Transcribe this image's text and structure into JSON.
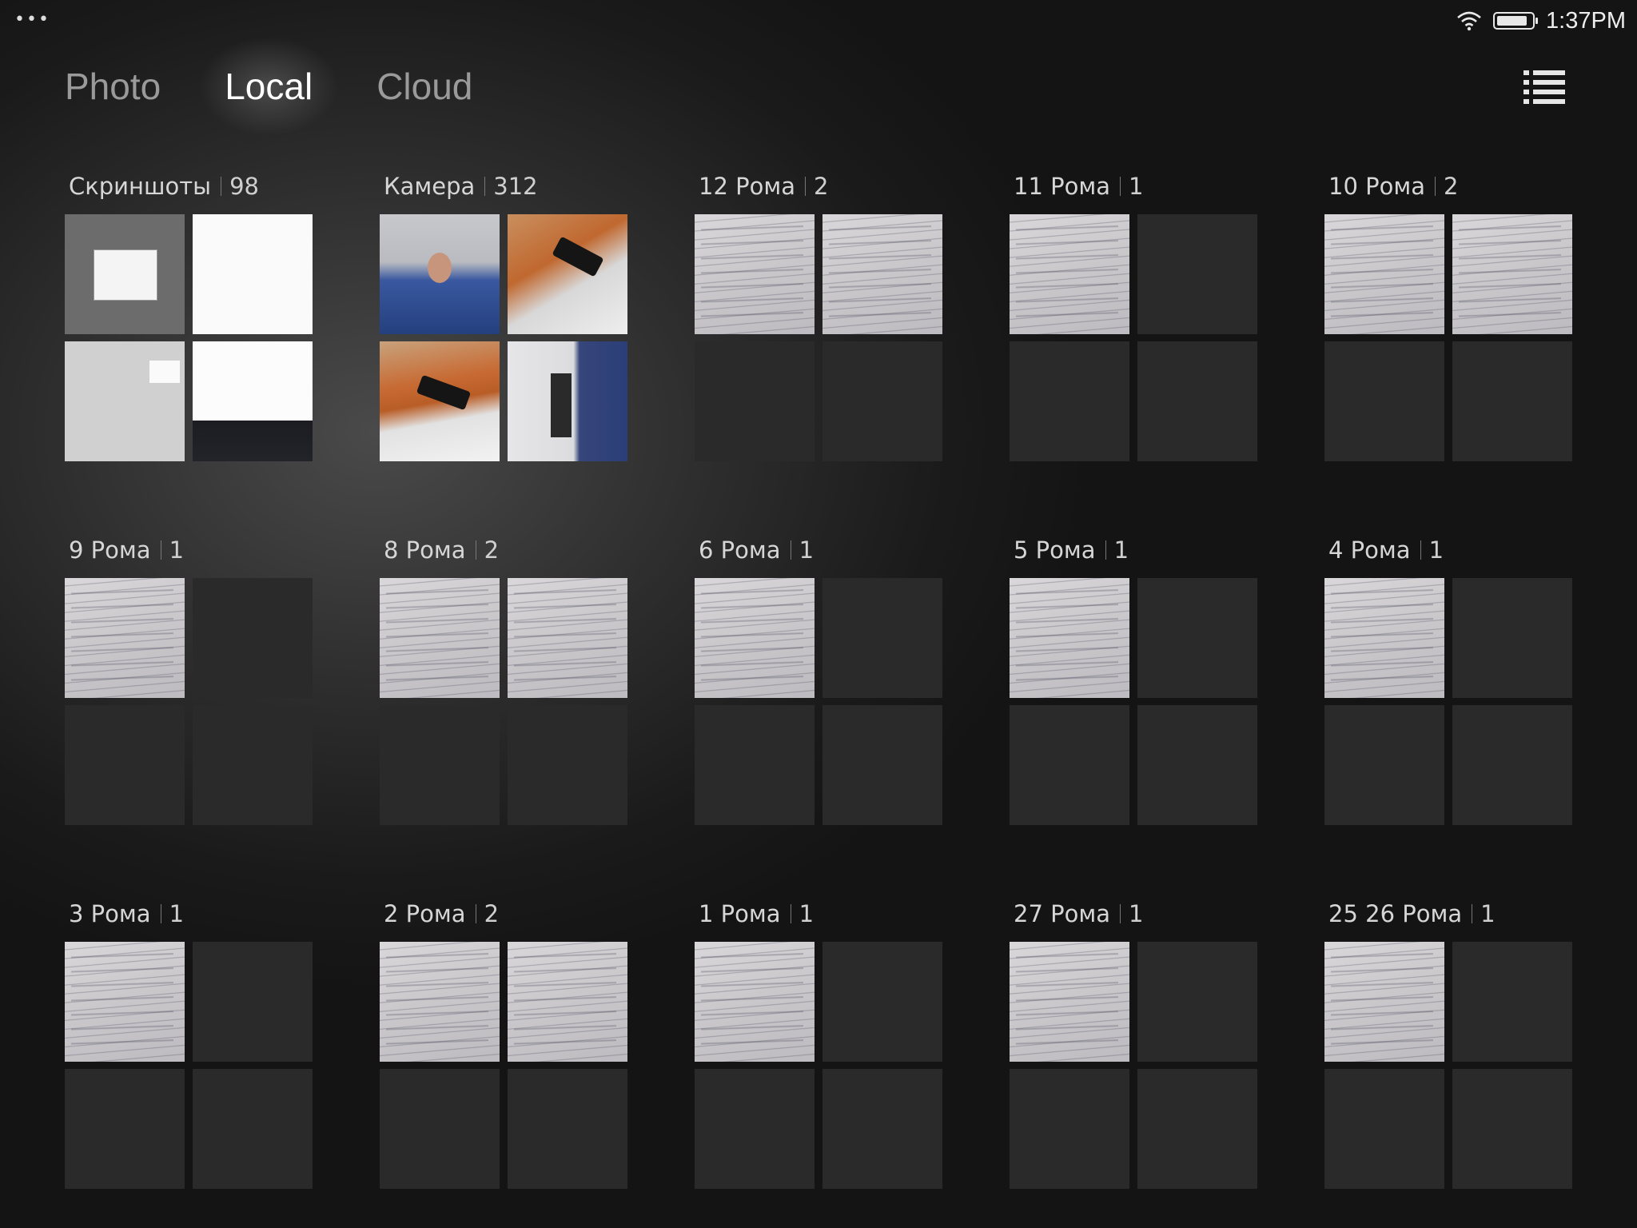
{
  "status_bar": {
    "time": "1:37PM",
    "more_icon": "more-dots-icon",
    "wifi_icon": "wifi-icon",
    "battery_icon": "battery-icon",
    "battery_level": 0.9
  },
  "tabs": [
    {
      "label": "Photo",
      "active": false
    },
    {
      "label": "Local",
      "active": true
    },
    {
      "label": "Cloud",
      "active": false
    }
  ],
  "view_toggle_icon": "list-view-icon",
  "albums": [
    {
      "name": "Скриншоты",
      "count": "98",
      "thumbs": [
        "shot-gray",
        "shot-white",
        "shot-light",
        "shot-kbd"
      ]
    },
    {
      "name": "Камера",
      "count": "312",
      "thumbs": [
        "cam-person",
        "cam-desk",
        "cam-desk2",
        "cam-room"
      ]
    },
    {
      "name": "12 Рома",
      "count": "2",
      "thumbs": [
        "paper",
        "paper",
        "empty",
        "empty"
      ]
    },
    {
      "name": "11 Рома",
      "count": "1",
      "thumbs": [
        "paper",
        "empty",
        "empty",
        "empty"
      ]
    },
    {
      "name": "10 Рома",
      "count": "2",
      "thumbs": [
        "paper",
        "paper",
        "empty",
        "empty"
      ]
    },
    {
      "name": "9 Рома",
      "count": "1",
      "thumbs": [
        "paper",
        "empty",
        "empty",
        "empty"
      ]
    },
    {
      "name": "8 Рома",
      "count": "2",
      "thumbs": [
        "paper",
        "paper",
        "empty",
        "empty"
      ]
    },
    {
      "name": "6 Рома",
      "count": "1",
      "thumbs": [
        "paper",
        "empty",
        "empty",
        "empty"
      ]
    },
    {
      "name": "5 Рома",
      "count": "1",
      "thumbs": [
        "paper",
        "empty",
        "empty",
        "empty"
      ]
    },
    {
      "name": "4 Рома",
      "count": "1",
      "thumbs": [
        "paper",
        "empty",
        "empty",
        "empty"
      ]
    },
    {
      "name": "3 Рома",
      "count": "1",
      "thumbs": [
        "paper",
        "empty",
        "empty",
        "empty"
      ]
    },
    {
      "name": "2 Рома",
      "count": "2",
      "thumbs": [
        "paper",
        "paper",
        "empty",
        "empty"
      ]
    },
    {
      "name": "1 Рома",
      "count": "1",
      "thumbs": [
        "paper",
        "empty",
        "empty",
        "empty"
      ]
    },
    {
      "name": "27 Рома",
      "count": "1",
      "thumbs": [
        "paper",
        "empty",
        "empty",
        "empty"
      ]
    },
    {
      "name": "25 26 Рома",
      "count": "1",
      "thumbs": [
        "paper",
        "empty",
        "empty",
        "empty"
      ]
    }
  ]
}
